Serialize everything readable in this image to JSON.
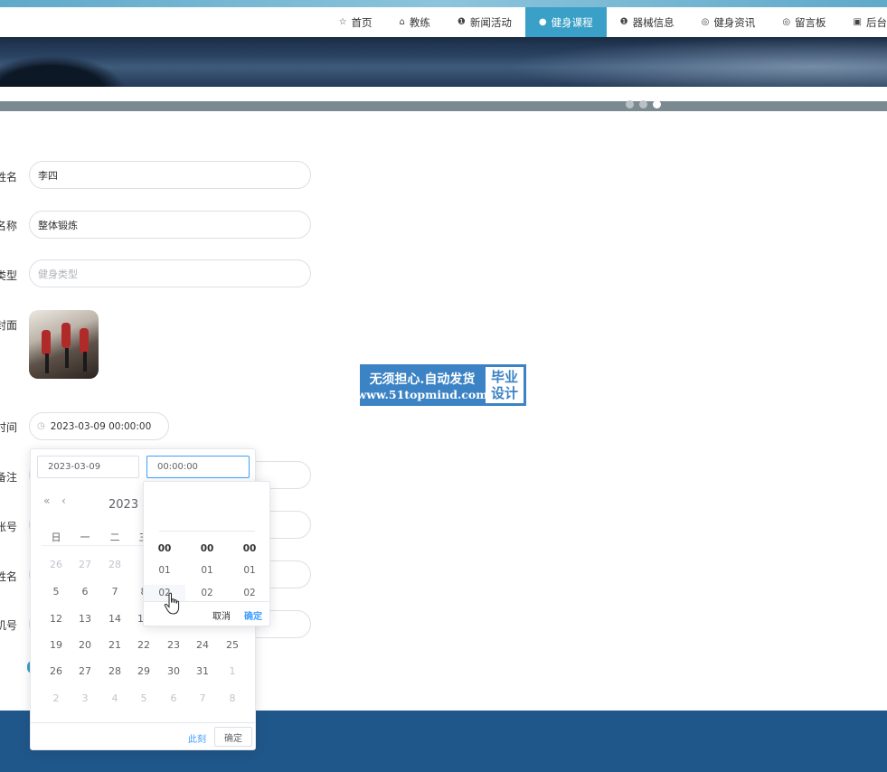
{
  "nav": {
    "items": [
      {
        "icon": "star-icon",
        "glyph": "☆",
        "label": "首页"
      },
      {
        "icon": "lock-icon",
        "glyph": "⌂",
        "label": "教练"
      },
      {
        "icon": "info-icon",
        "glyph": "❶",
        "label": "新闻活动"
      },
      {
        "icon": "question-icon",
        "glyph": "●",
        "label": "健身课程",
        "active": true
      },
      {
        "icon": "info-icon",
        "glyph": "❶",
        "label": "器械信息"
      },
      {
        "icon": "globe-icon",
        "glyph": "◎",
        "label": "健身资讯"
      },
      {
        "icon": "message-icon",
        "glyph": "◎",
        "label": "留言板"
      },
      {
        "icon": "calendar-icon",
        "glyph": "▣",
        "label": "后台"
      }
    ]
  },
  "form": {
    "rows": [
      {
        "label": "姓名",
        "value": "李四",
        "placeholder": ""
      },
      {
        "label": "名称",
        "value": "整体锻炼",
        "placeholder": ""
      },
      {
        "label": "类型",
        "value": "",
        "placeholder": "健身类型"
      },
      {
        "label": "封面"
      },
      {
        "label": "时间"
      },
      {
        "label": "备注"
      },
      {
        "label": "账号"
      },
      {
        "label": "姓名"
      },
      {
        "label": "机号"
      }
    ],
    "datetime_value": "2023-03-09 00:00:00"
  },
  "watermark": {
    "line1": "无须担心.自动发货",
    "line2": "www.51topmind.com",
    "right1": "毕业",
    "right2": "设计"
  },
  "picker": {
    "date_value": "2023-03-09",
    "time_value": "00:00:00",
    "header": "2023 年",
    "weekdays": [
      "日",
      "一",
      "二",
      "三"
    ],
    "days": [
      [
        "26",
        "27",
        "28"
      ],
      [
        "5",
        "6",
        "7",
        "8"
      ],
      [
        "12",
        "13",
        "14",
        "15"
      ],
      [
        "19",
        "20",
        "21",
        "22",
        "23",
        "24",
        "25"
      ],
      [
        "26",
        "27",
        "28",
        "29",
        "30",
        "31",
        "1"
      ],
      [
        "2",
        "3",
        "4",
        "5",
        "6",
        "7",
        "8"
      ]
    ],
    "now_label": "此刻",
    "ok_label": "确定"
  },
  "time_panel": {
    "hours": [
      "00",
      "01",
      "02"
    ],
    "minutes": [
      "00",
      "01",
      "02"
    ],
    "seconds": [
      "00",
      "01",
      "02"
    ],
    "cancel_label": "取消",
    "ok_label": "确定"
  },
  "colors": {
    "accent": "#3aa0c7",
    "footer": "#20578a",
    "picker_blue": "#409eff"
  }
}
